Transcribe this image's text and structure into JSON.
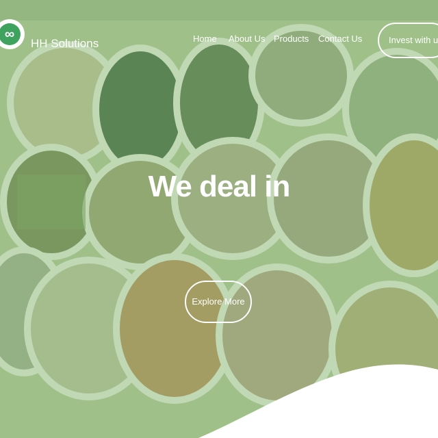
{
  "header": {
    "logo_icon": "infinity-icon",
    "logo_glyph": "∞",
    "brand_name": "HH Solutions",
    "nav": [
      "Home",
      "About Us",
      "Products",
      "Contact Us"
    ],
    "cta_label": "Invest with us"
  },
  "hero": {
    "headline": "We deal in",
    "button_label": "Explore More"
  },
  "colors": {
    "accent_green": "#3fa25f",
    "overlay_green": "#76aa68",
    "text": "#ffffff"
  }
}
